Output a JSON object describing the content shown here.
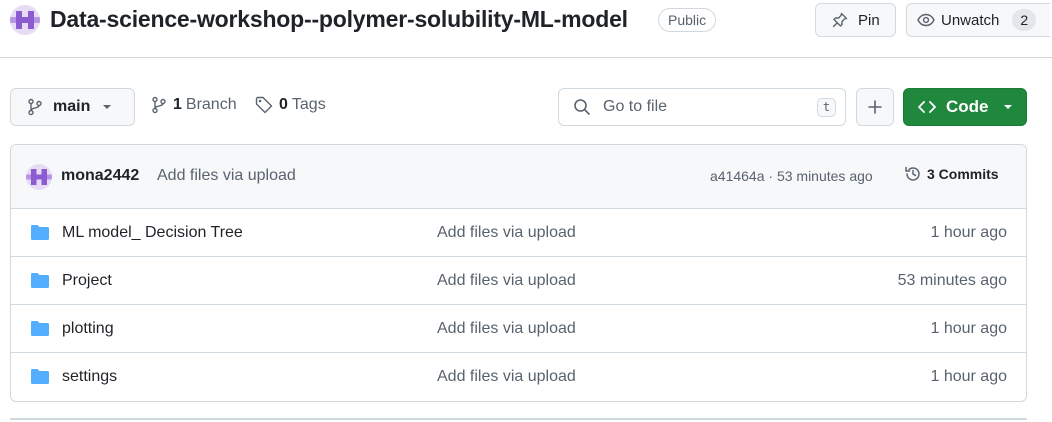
{
  "header": {
    "repo_name": "Data-science-workshop--polymer-solubility-ML-model",
    "visibility": "Public",
    "pin_label": "Pin",
    "watch_label": "Unwatch",
    "watch_count": "2"
  },
  "toolbar": {
    "branch_name": "main",
    "branch_count": "1",
    "branch_label": "Branch",
    "tag_count": "0",
    "tag_label": "Tags",
    "goto_placeholder": "Go to file",
    "goto_shortcut": "t",
    "add_label": "+",
    "code_label": "Code"
  },
  "latest_commit": {
    "author": "mona2442",
    "message": "Add files via upload",
    "sha_time": "a41464a · 53 minutes ago",
    "commits_label": "3 Commits"
  },
  "files": [
    {
      "name": "ML model_ Decision Tree",
      "message": "Add files via upload",
      "time": "1 hour ago",
      "icon": "folder-icon"
    },
    {
      "name": "Project",
      "message": "Add files via upload",
      "time": "53 minutes ago",
      "icon": "folder-icon"
    },
    {
      "name": "plotting",
      "message": "Add files via upload",
      "time": "1 hour ago",
      "icon": "folder-icon"
    },
    {
      "name": "settings",
      "message": "Add files via upload",
      "time": "1 hour ago",
      "icon": "folder-icon"
    }
  ],
  "colors": {
    "primary_green": "#1f883d",
    "folder_blue": "#54aeff",
    "avatar_purple": "#8c5bd0"
  }
}
